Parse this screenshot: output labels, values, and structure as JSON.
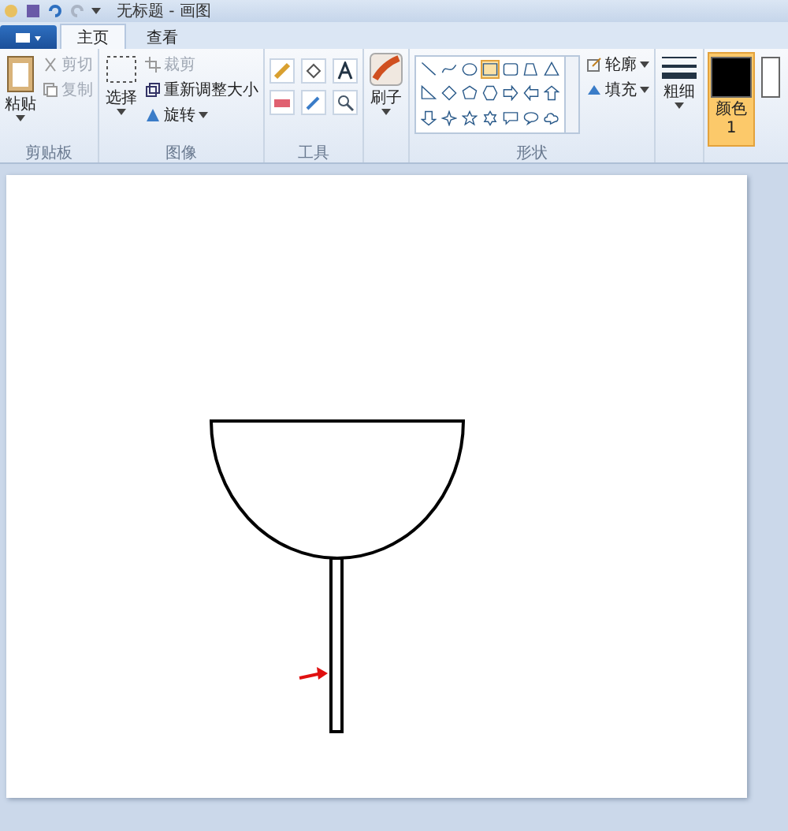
{
  "window": {
    "title": "无标题 - 画图"
  },
  "tabs": [
    {
      "label": "主页",
      "selected": true
    },
    {
      "label": "查看",
      "selected": false
    }
  ],
  "clipboard": {
    "label": "剪贴板",
    "paste": "粘贴",
    "cut": {
      "label": "剪切",
      "disabled": true
    },
    "copy": {
      "label": "复制",
      "disabled": true
    }
  },
  "image": {
    "label": "图像",
    "select": "选择",
    "crop": {
      "label": "裁剪",
      "disabled": true
    },
    "resize": "重新调整大小",
    "rotate": "旋转"
  },
  "tools": {
    "label": "工具"
  },
  "brushes": {
    "label": "刷子"
  },
  "shapes": {
    "label": "形状",
    "outline": "轮廓",
    "fill": "填充",
    "items": [
      {
        "kind": "line",
        "selected": false
      },
      {
        "kind": "curve",
        "selected": false
      },
      {
        "kind": "oval",
        "selected": false
      },
      {
        "kind": "rect",
        "selected": true
      },
      {
        "kind": "roundrect",
        "selected": false
      },
      {
        "kind": "polygon",
        "selected": false
      },
      {
        "kind": "triangle",
        "selected": false
      },
      {
        "kind": "righttriangle",
        "selected": false
      },
      {
        "kind": "diamond",
        "selected": false
      },
      {
        "kind": "pentagon",
        "selected": false
      },
      {
        "kind": "hexagon",
        "selected": false
      },
      {
        "kind": "arrowright",
        "selected": false
      },
      {
        "kind": "arrowleft",
        "selected": false
      },
      {
        "kind": "arrowup",
        "selected": false
      },
      {
        "kind": "arrowdown",
        "selected": false
      },
      {
        "kind": "star4",
        "selected": false
      },
      {
        "kind": "star5",
        "selected": false
      },
      {
        "kind": "star6",
        "selected": false
      },
      {
        "kind": "callout",
        "selected": false
      },
      {
        "kind": "calloutoval",
        "selected": false
      },
      {
        "kind": "cloud",
        "selected": false
      }
    ]
  },
  "size": {
    "label": "粗细"
  },
  "color1": {
    "label": "颜色 1",
    "selected": true,
    "color": "#000000"
  }
}
